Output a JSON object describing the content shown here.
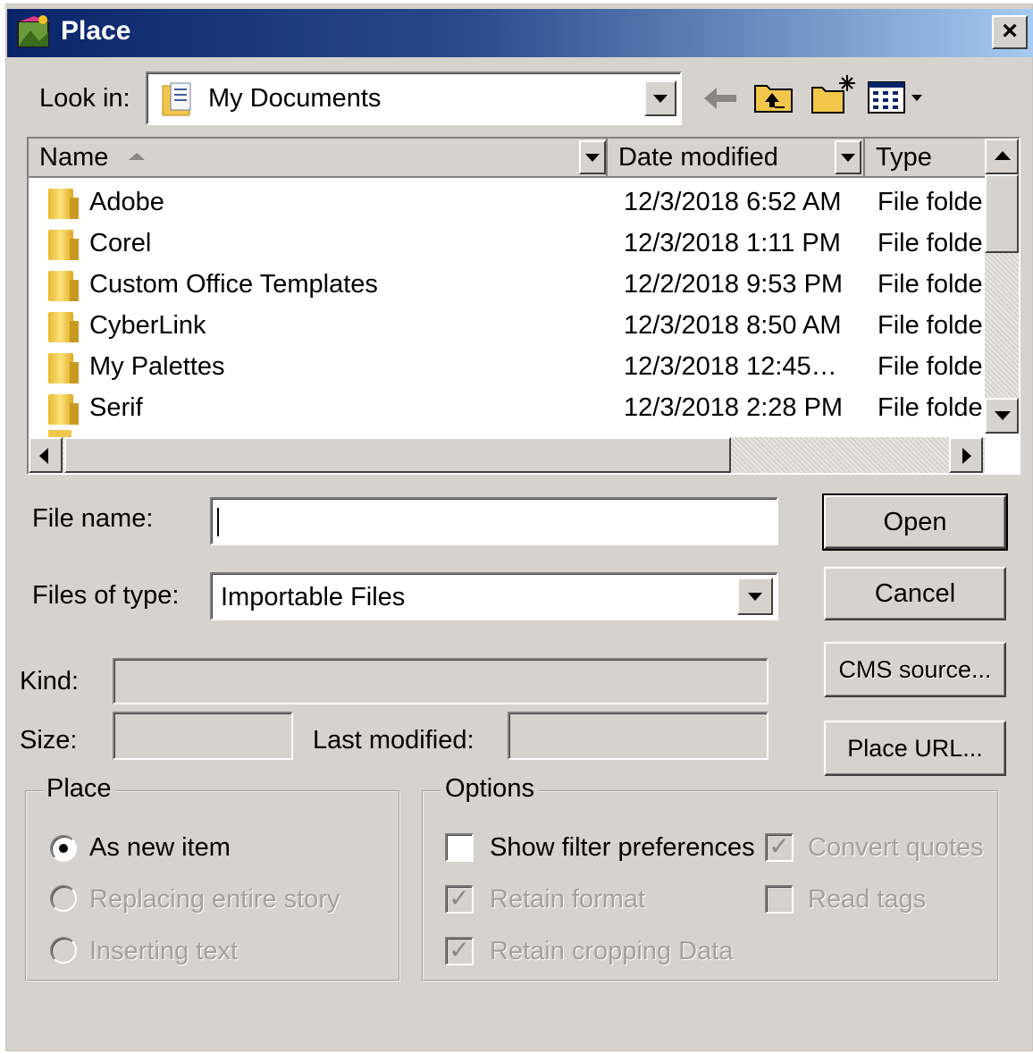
{
  "window": {
    "title": "Place",
    "close_label": "×"
  },
  "look_in": {
    "label": "Look in:",
    "value": "My Documents"
  },
  "toolbar": {
    "icons": [
      "back-arrow-icon",
      "up-folder-icon",
      "new-folder-icon",
      "view-menu-icon"
    ]
  },
  "columns": {
    "name": "Name",
    "date": "Date modified",
    "type": "Type"
  },
  "files": [
    {
      "name": "Adobe",
      "date": "12/3/2018 6:52 AM",
      "type": "File folde"
    },
    {
      "name": "Corel",
      "date": "12/3/2018 1:11 PM",
      "type": "File folde"
    },
    {
      "name": "Custom Office Templates",
      "date": "12/2/2018 9:53 PM",
      "type": "File folde"
    },
    {
      "name": "CyberLink",
      "date": "12/3/2018 8:50 AM",
      "type": "File folde"
    },
    {
      "name": "My Palettes",
      "date": "12/3/2018 12:45…",
      "type": "File folde"
    },
    {
      "name": "Serif",
      "date": "12/3/2018 2:28 PM",
      "type": "File folde"
    }
  ],
  "file_name": {
    "label": "File name:",
    "value": ""
  },
  "files_of_type": {
    "label": "Files of type:",
    "value": "Importable Files"
  },
  "buttons": {
    "open": "Open",
    "cancel": "Cancel",
    "cms_source": "CMS source...",
    "place_url": "Place URL..."
  },
  "info": {
    "kind_label": "Kind:",
    "size_label": "Size:",
    "last_modified_label": "Last modified:"
  },
  "place_group": {
    "title": "Place",
    "options": [
      {
        "label": "As new item",
        "checked": true,
        "enabled": true
      },
      {
        "label": "Replacing entire story",
        "checked": false,
        "enabled": false
      },
      {
        "label": "Inserting text",
        "checked": false,
        "enabled": false
      }
    ]
  },
  "options_group": {
    "title": "Options",
    "show_filter": {
      "label": "Show filter preferences",
      "checked": false,
      "enabled": true
    },
    "retain_format": {
      "label": "Retain format",
      "checked": true,
      "enabled": false
    },
    "retain_cropping": {
      "label": "Retain cropping Data",
      "checked": true,
      "enabled": false
    },
    "convert_quotes": {
      "label": "Convert quotes",
      "checked": true,
      "enabled": false
    },
    "read_tags": {
      "label": "Read tags",
      "checked": false,
      "enabled": false
    }
  },
  "colors": {
    "title_start": "#0a246a",
    "title_end": "#a6caf0",
    "face": "#d6d3ce"
  }
}
